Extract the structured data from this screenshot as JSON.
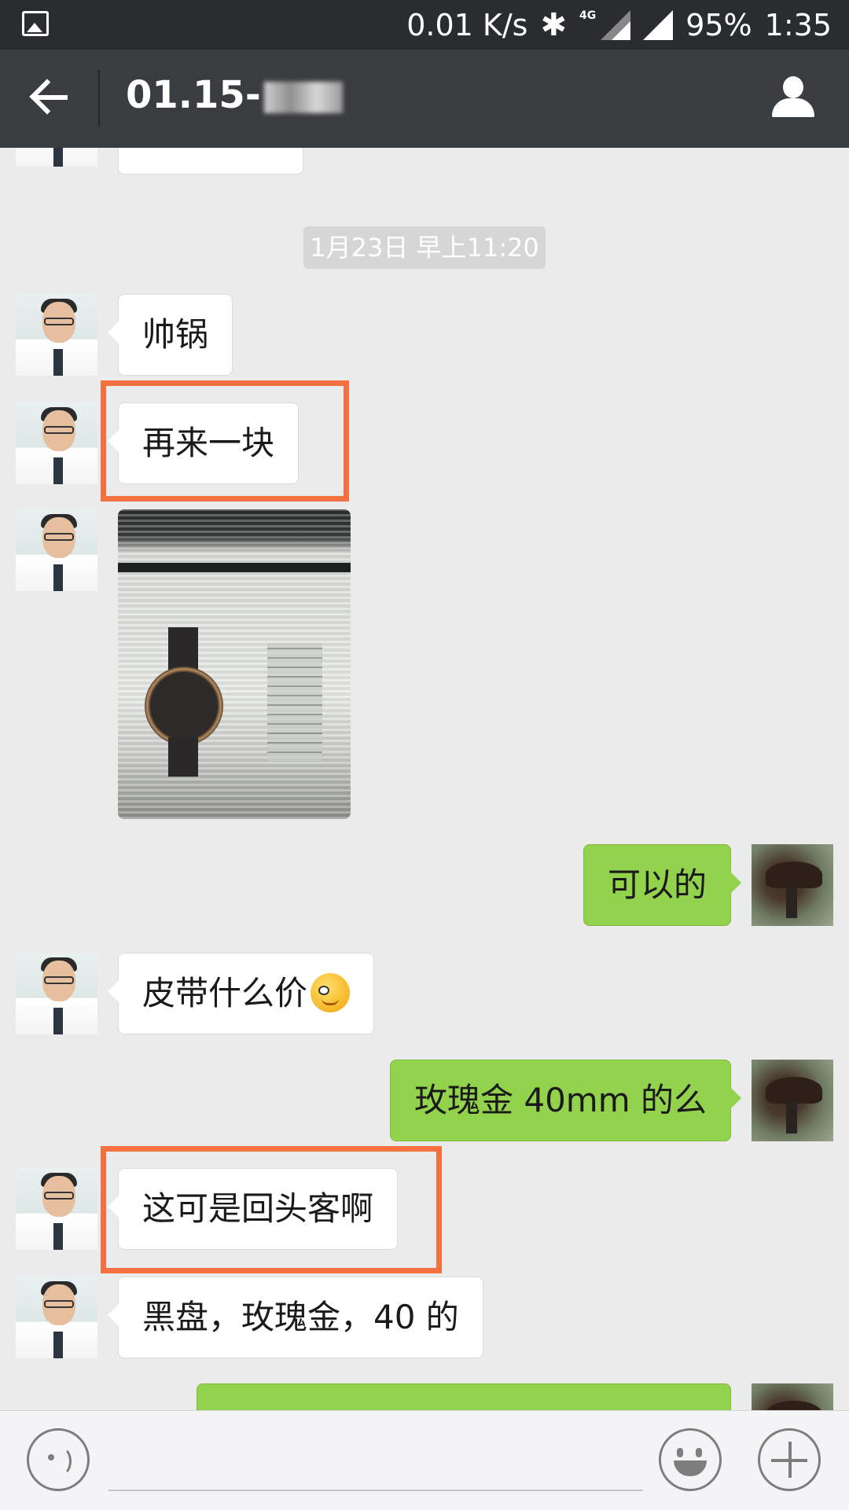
{
  "status_bar": {
    "network_speed": "0.01 K/s",
    "network_type": "4G",
    "battery": "95%",
    "time": "1:35"
  },
  "header": {
    "title": "01.15-"
  },
  "chat": {
    "timestamp": "1月23日 早上11:20",
    "messages": [
      {
        "side": "left",
        "type": "text",
        "text": "帅锅"
      },
      {
        "side": "left",
        "type": "text",
        "text": "再来一块",
        "highlighted": true
      },
      {
        "side": "left",
        "type": "image",
        "description_icon": "watch-photo"
      },
      {
        "side": "right",
        "type": "text",
        "text": "可以的"
      },
      {
        "side": "left",
        "type": "text",
        "text": "皮带什么价"
      },
      {
        "side": "right",
        "type": "text",
        "text": "玫瑰金 40mm 的么"
      },
      {
        "side": "left",
        "type": "text",
        "text": "这可是回头客啊",
        "highlighted": true
      },
      {
        "side": "left",
        "type": "text",
        "text": "黑盘，玫瑰金，40 的"
      },
      {
        "side": "right",
        "type": "text",
        "text": ""
      }
    ]
  },
  "colors": {
    "highlight": "#f57040",
    "sent_bubble": "#93d24d",
    "header_bg": "#3a3d40"
  }
}
